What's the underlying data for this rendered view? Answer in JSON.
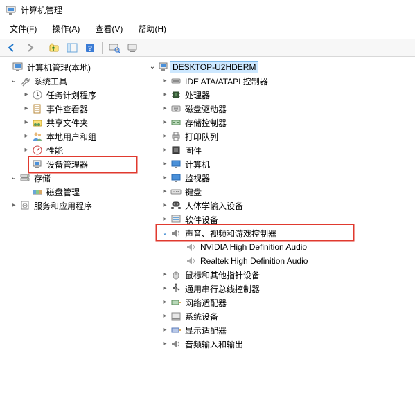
{
  "title": "计算机管理",
  "menu": {
    "file": "文件(F)",
    "action": "操作(A)",
    "view": "查看(V)",
    "help": "帮助(H)"
  },
  "left_tree": {
    "root": "计算机管理(本地)",
    "system_tools": "系统工具",
    "task_scheduler": "任务计划程序",
    "event_viewer": "事件查看器",
    "shared_folders": "共享文件夹",
    "local_users": "本地用户和组",
    "performance": "性能",
    "device_manager": "设备管理器",
    "storage": "存储",
    "disk_management": "磁盘管理",
    "services_apps": "服务和应用程序"
  },
  "right_tree": {
    "computer": "DESKTOP-U2HDERM",
    "ide": "IDE ATA/ATAPI 控制器",
    "processors": "处理器",
    "disk_drives": "磁盘驱动器",
    "storage_controllers": "存储控制器",
    "print_queues": "打印队列",
    "firmware": "固件",
    "computers": "计算机",
    "monitors": "监视器",
    "keyboards": "键盘",
    "hid": "人体学输入设备",
    "software": "软件设备",
    "sound": "声音、视频和游戏控制器",
    "nvidia_audio": "NVIDIA High Definition Audio",
    "realtek_audio": "Realtek High Definition Audio",
    "mice": "鼠标和其他指针设备",
    "usb": "通用串行总线控制器",
    "network": "网络适配器",
    "system_devices": "系统设备",
    "display": "显示适配器",
    "audio_io": "音频输入和输出"
  }
}
